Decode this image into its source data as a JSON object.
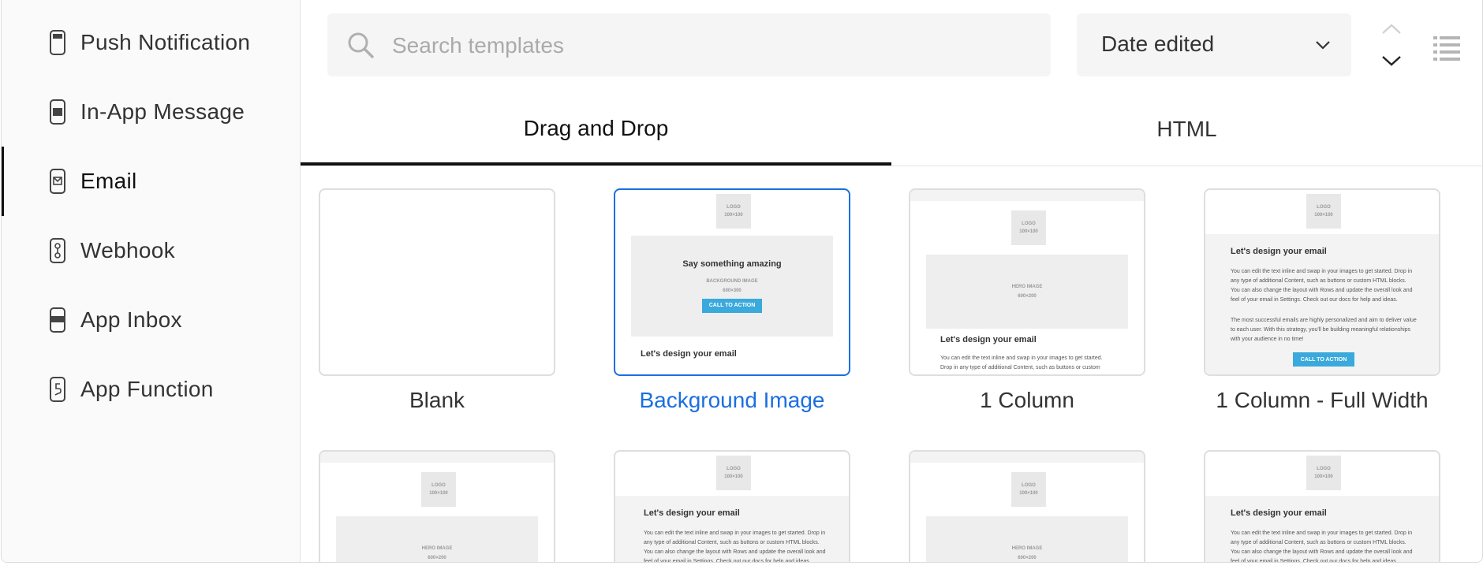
{
  "sidebar": {
    "items": [
      {
        "label": "Push Notification",
        "icon": "push-notification-icon"
      },
      {
        "label": "In-App Message",
        "icon": "in-app-message-icon"
      },
      {
        "label": "Email",
        "icon": "email-icon",
        "active": true
      },
      {
        "label": "Webhook",
        "icon": "webhook-icon"
      },
      {
        "label": "App Inbox",
        "icon": "app-inbox-icon"
      },
      {
        "label": "App Function",
        "icon": "app-function-icon"
      }
    ]
  },
  "toolbar": {
    "search_placeholder": "Search templates",
    "sort_label": "Date edited"
  },
  "tabs": [
    {
      "label": "Drag and Drop",
      "active": true
    },
    {
      "label": "HTML",
      "active": false
    }
  ],
  "templates": [
    {
      "title": "Blank"
    },
    {
      "title": "Background Image",
      "selected": true
    },
    {
      "title": "1 Column"
    },
    {
      "title": "1 Column - Full Width"
    }
  ],
  "preview": {
    "logo": "LOGO",
    "logo_size": "100×100",
    "hero_label": "HERO IMAGE",
    "hero_size": "600×200",
    "bg_label": "BACKGROUND IMAGE",
    "bg_size": "600×300",
    "say_something": "Say something amazing",
    "cta": "CALL TO ACTION",
    "heading": "Let's design your email",
    "body1": "You can edit the text inline and swap in your images to get started. Drop in any type of additional Content, such as buttons or custom HTML blocks. You can also change the layout with Rows and update the overall look and feel of your email in Settings. Check out our docs for help and ideas.",
    "body2": "The most successful emails are highly personalized and aim to deliver value to each user. With this strategy, you'll be building meaningful relationships with your audience in no time!"
  },
  "colors": {
    "accent": "#1a6fe0",
    "cta": "#3aa9db"
  }
}
